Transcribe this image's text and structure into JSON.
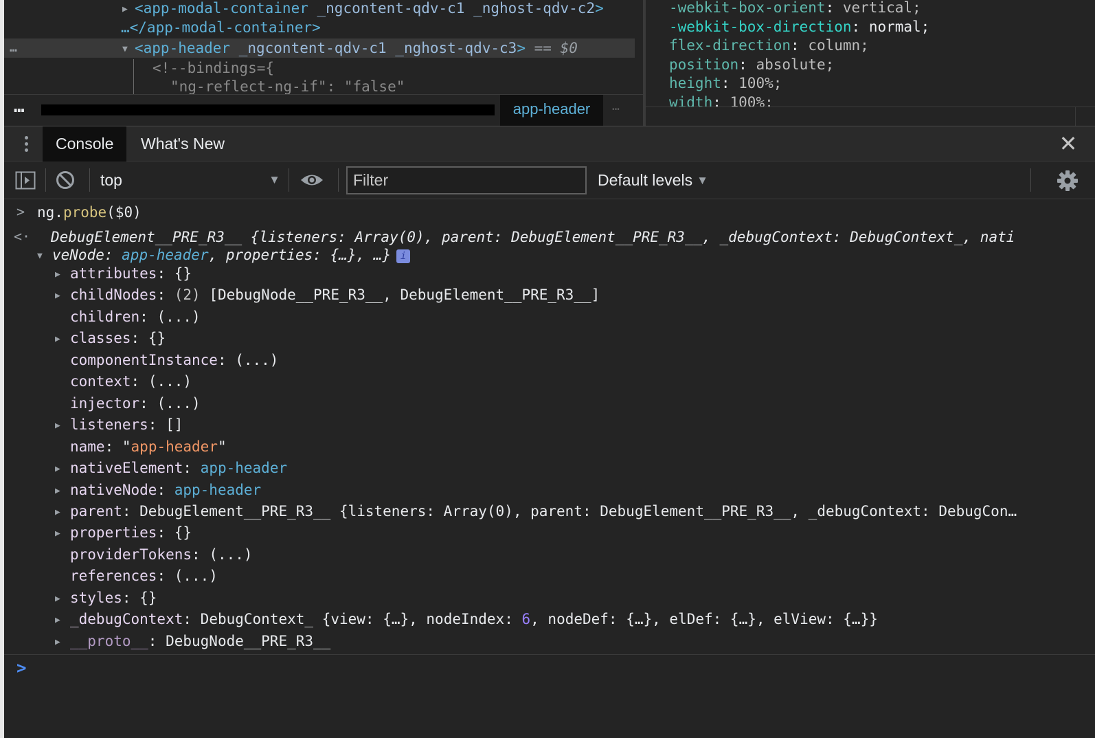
{
  "elements": {
    "line1_tag_open": "<app-modal-container",
    "line1_attrs": " _ngcontent-qdv-c1 _nghost-qdv-c2",
    "line1_tag_close": ">",
    "line2": "…</app-modal-container>",
    "selected_tag_open": "<app-header",
    "selected_attrs": " _ngcontent-qdv-c1 _nghost-qdv-c3",
    "selected_tag_close": ">",
    "selected_eq": " == ",
    "selected_ref": "$0",
    "row_dots": "…",
    "comment_line": "<!--bindings={",
    "comment_line2": "\"ng-reflect-ng-if\": \"false\""
  },
  "styles": [
    {
      "prop": "-webkit-box-orient",
      "value": "vertical",
      "dim": true
    },
    {
      "prop": "-webkit-box-direction",
      "value": "normal",
      "dim": false
    },
    {
      "prop": "flex-direction",
      "value": "column",
      "dim": true
    },
    {
      "prop": "position",
      "value": "absolute",
      "dim": true
    },
    {
      "prop": "height",
      "value": "100%",
      "dim": true
    },
    {
      "prop": "width",
      "value": "100%",
      "dim": true
    }
  ],
  "breadcrumb": {
    "dots": "…",
    "active": "app-header",
    "more": "…"
  },
  "drawer": {
    "tabs": [
      {
        "label": "Console"
      },
      {
        "label": "What's New"
      }
    ],
    "close": "✕"
  },
  "toolbar": {
    "context": "top",
    "filter_placeholder": "Filter",
    "levels": "Default levels"
  },
  "console": {
    "command": {
      "obj": "ng",
      "dot": ".",
      "fn": "probe",
      "args": "($0)"
    },
    "result_line1": "DebugElement__PRE_R3__ {listeners: Array(0), parent: DebugElement__PRE_R3__, _debugContext: DebugContext_, nati",
    "result_line2_a": "veNode: ",
    "result_line2_node": "app-header",
    "result_line2_b": ", properties: {…}, …}",
    "info_badge": "i",
    "props": [
      {
        "key": "attributes",
        "value": "{}",
        "expandable": true
      },
      {
        "key": "childNodes",
        "value_gray": "(2) ",
        "value": "[DebugNode__PRE_R3__, DebugElement__PRE_R3__]",
        "expandable": true
      },
      {
        "key": "children",
        "value": "(...)",
        "expandable": false
      },
      {
        "key": "classes",
        "value": "{}",
        "expandable": true
      },
      {
        "key": "componentInstance",
        "value": "(...)",
        "expandable": false
      },
      {
        "key": "context",
        "value": "(...)",
        "expandable": false
      },
      {
        "key": "injector",
        "value": "(...)",
        "expandable": false
      },
      {
        "key": "listeners",
        "value": "[]",
        "expandable": true
      },
      {
        "key": "name",
        "value_str": "app-header",
        "expandable": false
      },
      {
        "key": "nativeElement",
        "value_node": "app-header",
        "expandable": true
      },
      {
        "key": "nativeNode",
        "value_node": "app-header",
        "expandable": true
      },
      {
        "key": "parent",
        "value_gray": "DebugElement__PRE_R3__ ",
        "value": "{listeners: Array(0), parent: DebugElement__PRE_R3__, _debugContext: DebugCon…",
        "expandable": true
      },
      {
        "key": "properties",
        "value": "{}",
        "expandable": true
      },
      {
        "key": "providerTokens",
        "value": "(...)",
        "expandable": false
      },
      {
        "key": "references",
        "value": "(...)",
        "expandable": false
      },
      {
        "key": "styles",
        "value": "{}",
        "expandable": true
      },
      {
        "key": "_debugContext",
        "value_gray": "DebugContext_ ",
        "value_pre": "{view: {…}, nodeIndex: ",
        "value_num": "6",
        "value_post": ", nodeDef: {…}, elDef: {…}, elView: {…}}",
        "expandable": true
      },
      {
        "key": "__proto__",
        "value": "DebugNode__PRE_R3__",
        "expandable": true,
        "dim": true
      }
    ]
  }
}
